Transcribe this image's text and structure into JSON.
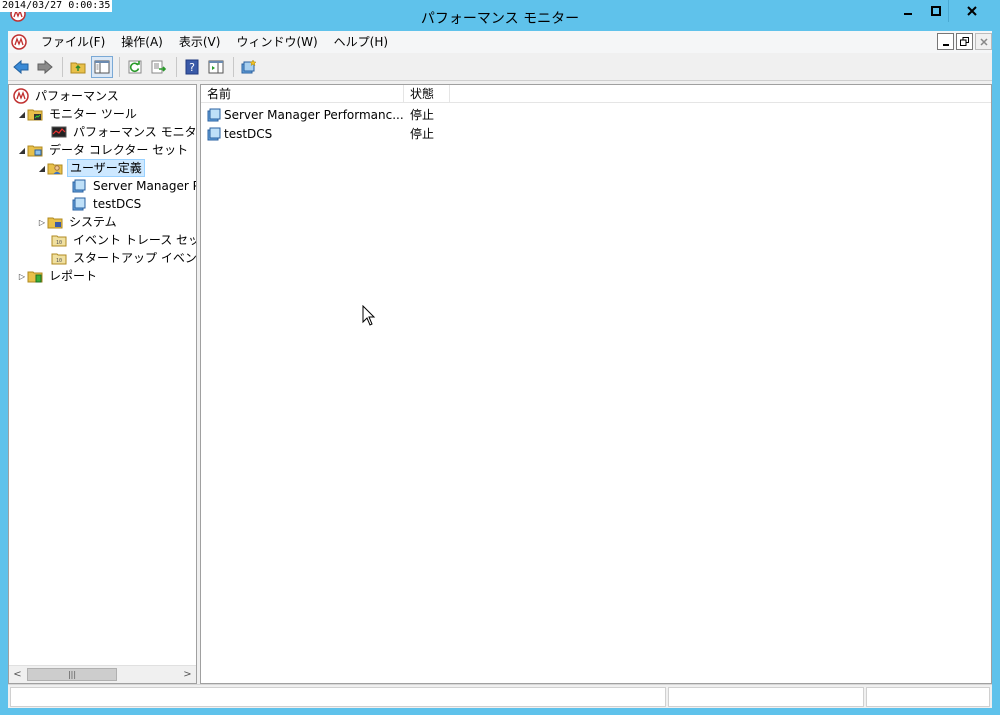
{
  "timestamp": "2014/03/27 0:00:35",
  "window": {
    "title": "パフォーマンス モニター"
  },
  "menu": [
    "ファイル(F)",
    "操作(A)",
    "表示(V)",
    "ウィンドウ(W)",
    "ヘルプ(H)"
  ],
  "tree": {
    "root": "パフォーマンス",
    "monitoring_tools": "モニター ツール",
    "perf_monitor": "パフォーマンス モニター",
    "data_collector_sets": "データ コレクター セット",
    "user_defined": "ユーザー定義",
    "server_manager": "Server Manager P",
    "testdcs": "testDCS",
    "system": "システム",
    "event_trace": "イベント トレース セッション",
    "startup_trace": "スタートアップ イベント トレ",
    "reports": "レポート"
  },
  "list": {
    "columns": {
      "name": "名前",
      "status": "状態"
    },
    "rows": [
      {
        "name": "Server Manager Performanc...",
        "status": "停止"
      },
      {
        "name": "testDCS",
        "status": "停止"
      }
    ]
  },
  "colors": {
    "titlebar": "#5fc2eb",
    "selection": "#cde8ff"
  }
}
